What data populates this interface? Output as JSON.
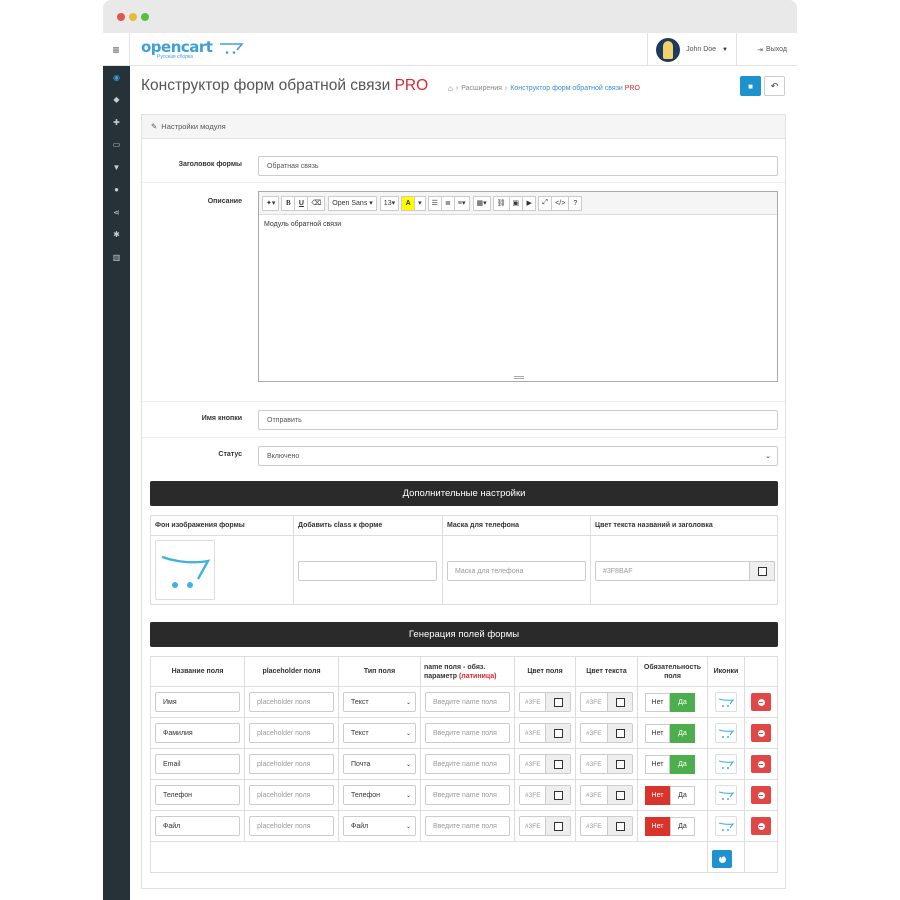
{
  "header": {
    "logo_text": "opencart",
    "logo_sub": "Русская сборка",
    "user_name": "John Doe",
    "logout_label": "Выход"
  },
  "page": {
    "title": "Конструктор форм обратной связи",
    "title_suffix": "PRO",
    "breadcrumb_home_icon": "home-icon",
    "breadcrumb_extensions": "Расширения",
    "breadcrumb_active": "Конструктор форм обратной связи",
    "breadcrumb_active_suffix": "PRO"
  },
  "panel": {
    "title": "Настройки модуля"
  },
  "form": {
    "heading_label": "Заголовок формы",
    "heading_value": "Обратная связь",
    "description_label": "Описание",
    "description_value": "Модуль обратной связи",
    "button_name_label": "Имя кнопки",
    "button_name_value": "Отправить",
    "status_label": "Статус",
    "status_value": "Включено"
  },
  "editor_toolbar": {
    "font": "Open Sans",
    "size": "13",
    "bold": "B",
    "underline": "U",
    "color": "A",
    "help": "?"
  },
  "extra": {
    "title": "Дополнительные настройки",
    "columns": [
      "Фон изображения формы",
      "Добавить class к форме",
      "Маска для телефона",
      "Цвет текста названий и заголовка"
    ],
    "class_value": "",
    "mask_placeholder": "Маска для телефона",
    "text_color": "#3F8BAF"
  },
  "fields": {
    "title": "Генерация полей формы",
    "columns": {
      "name": "Название поля",
      "placeholder": "placeholder поля",
      "type": "Тип поля",
      "param": "name поля - обяз. параметр",
      "param_red": "(латиница)",
      "field_color": "Цвет поля",
      "text_color": "Цвет текста",
      "required": "Обязательность поля",
      "icons": "Иконки"
    },
    "rows": [
      {
        "name": "Имя",
        "placeholder": "placeholder поля",
        "type": "Текст",
        "param_placeholder": "Введите name поля",
        "color": "#3FE",
        "text_color": "#3FE",
        "no": "Нет",
        "yes": "Да",
        "required": false
      },
      {
        "name": "Фамилия",
        "placeholder": "placeholder поля",
        "type": "Текст",
        "param_placeholder": "Введите name поля",
        "color": "#3FE",
        "text_color": "#3FE",
        "no": "Нет",
        "yes": "Да",
        "required": false
      },
      {
        "name": "Email",
        "placeholder": "placeholder поля",
        "type": "Почта",
        "param_placeholder": "Введите name поля",
        "color": "#3FE",
        "text_color": "#3FE",
        "no": "Нет",
        "yes": "Да",
        "required": false
      },
      {
        "name": "Телефон",
        "placeholder": "placeholder поля",
        "type": "Телефон",
        "param_placeholder": "Введите name поля",
        "color": "#3FE",
        "text_color": "#3FE",
        "no": "Нет",
        "yes": "Да",
        "required": true
      },
      {
        "name": "Файл",
        "placeholder": "placeholder поля",
        "type": "Файл",
        "param_placeholder": "Введите name поля",
        "color": "#3FE",
        "text_color": "#3FE",
        "no": "Нет",
        "yes": "Да",
        "required": true
      }
    ]
  },
  "colors": {
    "accent": "#1e91cf",
    "sidebar": "#263238",
    "danger": "#e04848",
    "success": "#4cae4c",
    "pro": "#d7282f"
  }
}
